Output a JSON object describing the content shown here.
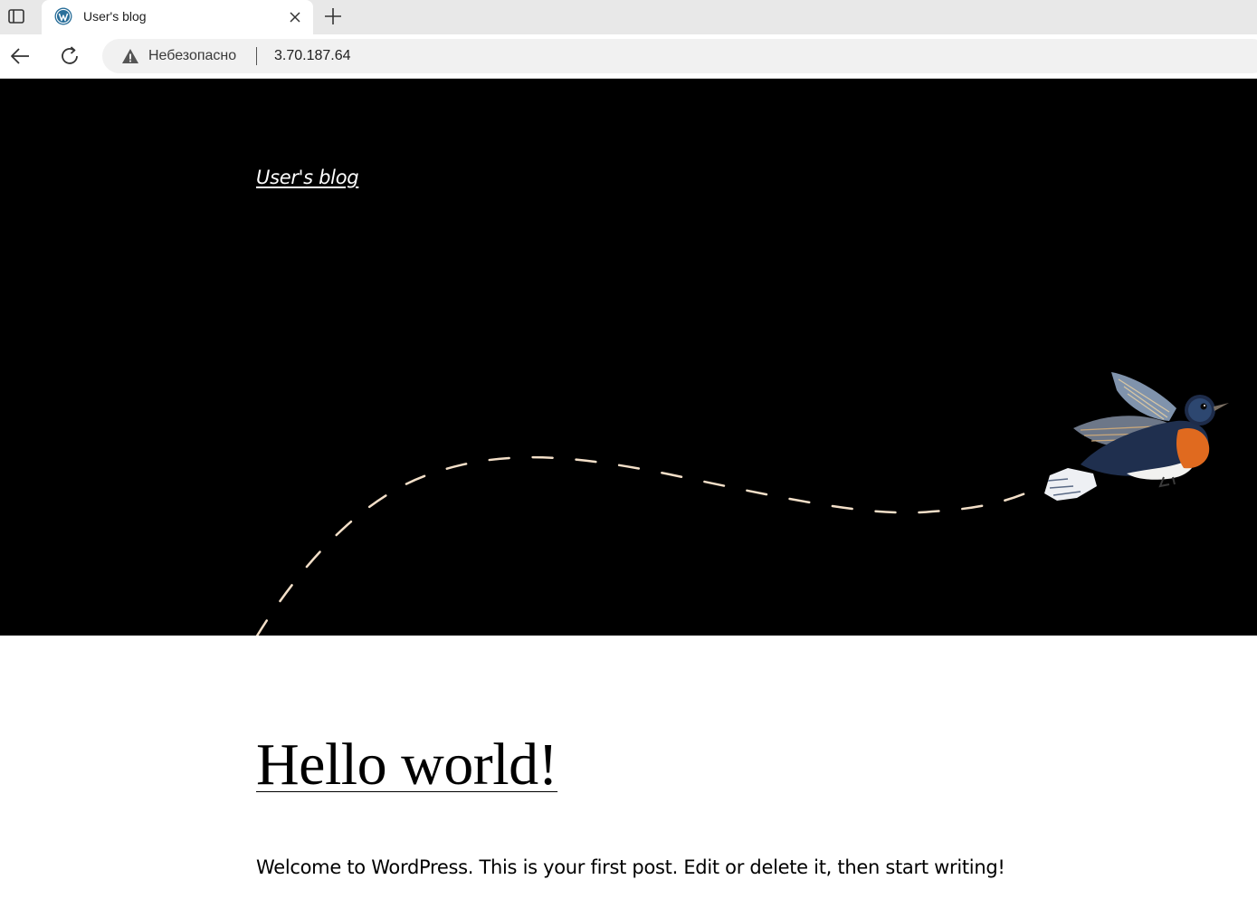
{
  "browser": {
    "tab": {
      "title": "User's blog",
      "favicon": "wordpress-icon"
    },
    "address_bar": {
      "security_label": "Небезопасно",
      "url": "3.70.187.64",
      "security_icon": "warning-icon"
    },
    "icons": {
      "tab_actions": "tab-actions-icon",
      "close": "close-icon",
      "new_tab": "plus-icon",
      "back": "back-arrow-icon",
      "reload": "reload-icon"
    }
  },
  "site": {
    "title": "User's blog",
    "header_image": "bird-illustration",
    "colors": {
      "header_background": "#000000",
      "flight_path": "#f3dfc8"
    }
  },
  "post": {
    "title": "Hello world!",
    "excerpt": "Welcome to WordPress. This is your first post. Edit or delete it, then start writing!"
  }
}
